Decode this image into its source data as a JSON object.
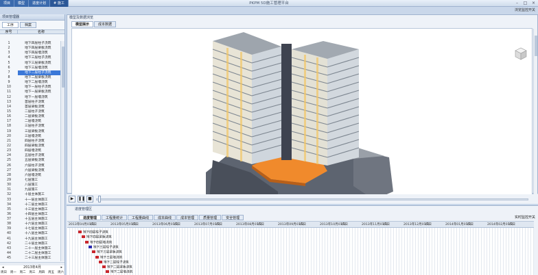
{
  "app": {
    "title": "PKPM 5D施工管理平台",
    "menu": [
      "项目",
      "模型",
      "进度计划",
      "# 施工"
    ],
    "top_toggle": "浏览监控开关"
  },
  "left_panel": {
    "title": "项目管理器",
    "tabs": [
      "工序",
      "档案"
    ],
    "col_num": "序号",
    "col_name": "名称",
    "rows": [
      {
        "num": "1",
        "name": "地下四层柱子浇筑"
      },
      {
        "num": "2",
        "name": "地下四层梁板浇筑"
      },
      {
        "num": "3",
        "name": "地下四层墙浇筑"
      },
      {
        "num": "4",
        "name": "地下三层柱子浇筑"
      },
      {
        "num": "5",
        "name": "地下三层梁板浇筑"
      },
      {
        "num": "6",
        "name": "地下三层墙浇筑"
      },
      {
        "num": "7",
        "name": "地下二层柱子浇筑"
      },
      {
        "num": "8",
        "name": "地下二层梁板浇筑"
      },
      {
        "num": "9",
        "name": "地下二层墙浇筑"
      },
      {
        "num": "10",
        "name": "地下一层柱子浇筑"
      },
      {
        "num": "11",
        "name": "地下一层梁板浇筑"
      },
      {
        "num": "12",
        "name": "地下一层墙浇筑"
      },
      {
        "num": "13",
        "name": "首层柱子浇筑"
      },
      {
        "num": "14",
        "name": "首层梁板浇筑"
      },
      {
        "num": "15",
        "name": "二层柱子浇筑"
      },
      {
        "num": "16",
        "name": "二层梁板浇筑"
      },
      {
        "num": "17",
        "name": "二层墙浇筑"
      },
      {
        "num": "18",
        "name": "三层柱子浇筑"
      },
      {
        "num": "19",
        "name": "三层梁板浇筑"
      },
      {
        "num": "20",
        "name": "三层墙浇筑"
      },
      {
        "num": "21",
        "name": "四层柱子浇筑"
      },
      {
        "num": "22",
        "name": "四层梁板浇筑"
      },
      {
        "num": "23",
        "name": "四层墙浇筑"
      },
      {
        "num": "24",
        "name": "五层柱子浇筑"
      },
      {
        "num": "25",
        "name": "五层梁板浇筑"
      },
      {
        "num": "26",
        "name": "六层柱子浇筑"
      },
      {
        "num": "27",
        "name": "六层梁板浇筑"
      },
      {
        "num": "28",
        "name": "六层墙浇筑"
      },
      {
        "num": "29",
        "name": "七层施工"
      },
      {
        "num": "30",
        "name": "八层施工"
      },
      {
        "num": "31",
        "name": "九层施工"
      },
      {
        "num": "32",
        "name": "十层主体施工"
      },
      {
        "num": "33",
        "name": "十一层主体施工"
      },
      {
        "num": "34",
        "name": "十二层主体施工"
      },
      {
        "num": "35",
        "name": "十三层主体施工"
      },
      {
        "num": "36",
        "name": "十四层主体施工"
      },
      {
        "num": "37",
        "name": "十五层主体施工"
      },
      {
        "num": "38",
        "name": "十六层主体施工"
      },
      {
        "num": "39",
        "name": "十七层主体施工"
      },
      {
        "num": "40",
        "name": "十八层主体施工"
      },
      {
        "num": "41",
        "name": "十九层主体施工"
      },
      {
        "num": "42",
        "name": "二十层主体施工"
      },
      {
        "num": "43",
        "name": "二十一层主体施工"
      },
      {
        "num": "44",
        "name": "二十二层主体施工"
      },
      {
        "num": "45",
        "name": "二十三层主体施工"
      }
    ],
    "selected_index": 6,
    "calendar": {
      "month": "2013年4月",
      "days": [
        "周日",
        "周一",
        "周二",
        "周三",
        "周四",
        "周五",
        "周六"
      ]
    }
  },
  "main_panel": {
    "title": "模型及数据浏览",
    "tabs": [
      "模型展示",
      "成本数据"
    ]
  },
  "playback": {
    "play": "▶",
    "pause": "❚❚",
    "stop": "■",
    "position_fraction": 0.005
  },
  "progress_panel": {
    "title": "进度管理区",
    "tabs": [
      "进度管理",
      "工程量统计",
      "工程量曲线",
      "成本曲线",
      "成本管理",
      "质量管理",
      "安全管理"
    ],
    "toggle_label": "实时监控开关",
    "gantt_header": [
      "2013年04月01日",
      "15日",
      "2013年05月01日",
      "15日",
      "2013年06月01日",
      "15日",
      "2013年07月01日",
      "15日",
      "2013年08月01日",
      "15日",
      "2013年09月01日",
      "15日",
      "2013年10月01日",
      "15日",
      "2013年11月01日",
      "15日",
      "2013年12月01日",
      "15日",
      "2014年01月01日",
      "15日",
      "2014年02月01日",
      "15日"
    ],
    "gantt_tasks": [
      {
        "label": "地下四层柱子浇筑",
        "color": "#c8262c"
      },
      {
        "label": "地下四层梁板浇筑",
        "color": "#c8262c"
      },
      {
        "label": "地下四层墙浇筑",
        "color": "#c8262c"
      },
      {
        "label": "地下三层柱子浇筑",
        "color": "#2b2bb0"
      },
      {
        "label": "地下三层梁板浇筑",
        "color": "#c8262c"
      },
      {
        "label": "地下三层墙浇筑",
        "color": "#c8262c"
      },
      {
        "label": "地下二层柱子浇筑",
        "color": "#c8262c"
      },
      {
        "label": "地下二层梁板浇筑",
        "color": "#c8262c"
      },
      {
        "label": "地下二层墙浇筑",
        "color": "#c8262c"
      }
    ]
  }
}
